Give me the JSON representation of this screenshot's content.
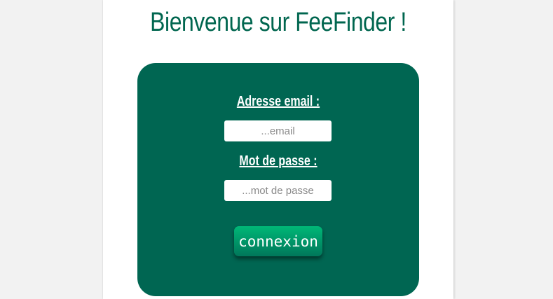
{
  "title": "Bienvenue sur FeeFinder !",
  "login_form": {
    "email_label": "Adresse email :",
    "email_placeholder": "...email",
    "email_value": "",
    "password_label": "Mot de passe :",
    "password_placeholder": "...mot de passe",
    "password_value": "",
    "submit_label": "connexion"
  },
  "colors": {
    "background": "#f2f2f2",
    "page": "#ffffff",
    "brand_green": "#006652",
    "title_green": "#00664f",
    "button_gradient_top": "#00b877",
    "button_gradient_bottom": "#00775a"
  }
}
